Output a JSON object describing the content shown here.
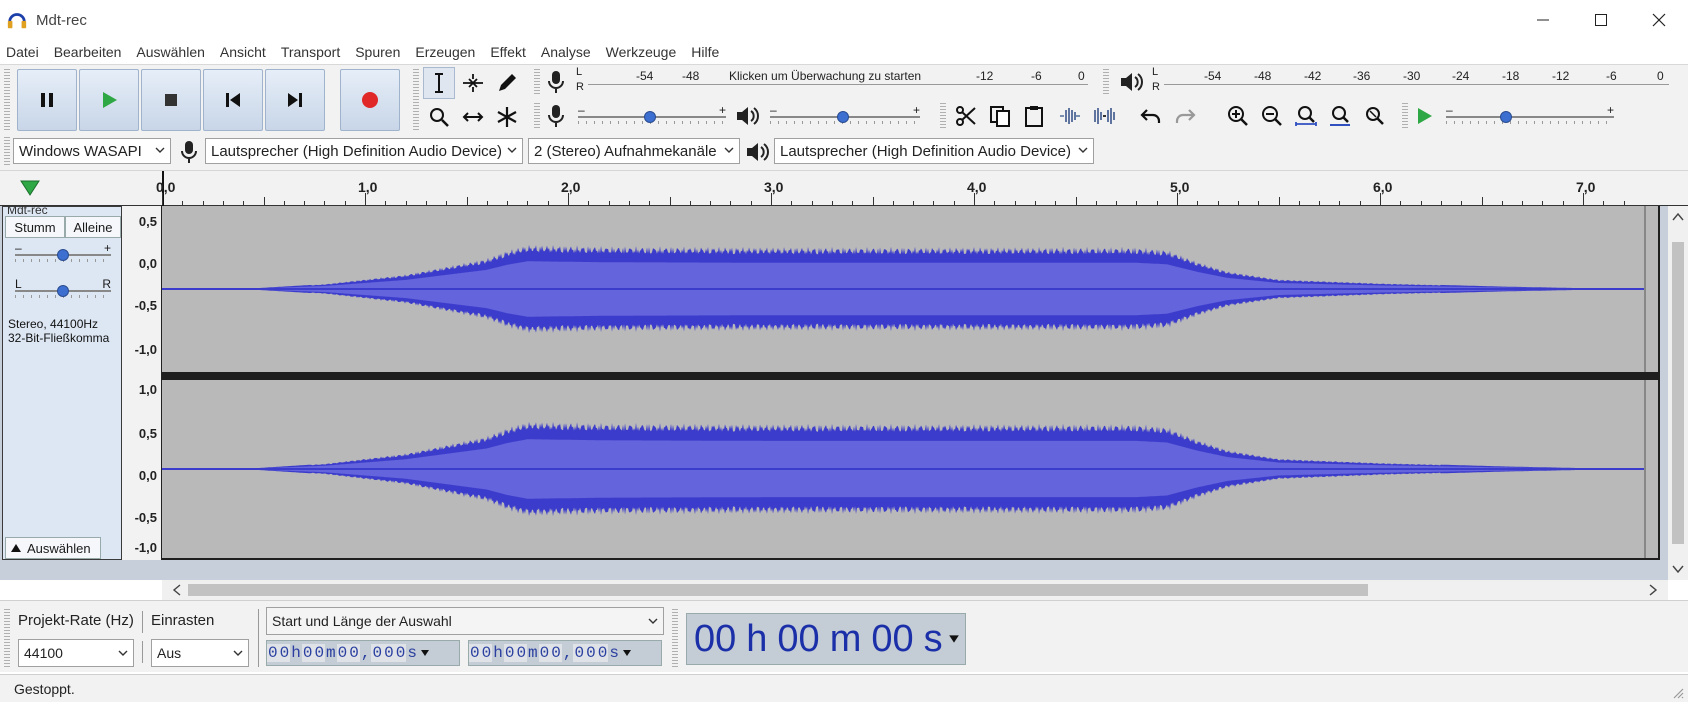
{
  "window": {
    "title": "Mdt-rec"
  },
  "menu": [
    "Datei",
    "Bearbeiten",
    "Auswählen",
    "Ansicht",
    "Transport",
    "Spuren",
    "Erzeugen",
    "Effekt",
    "Analyse",
    "Werkzeuge",
    "Hilfe"
  ],
  "record_meter": {
    "channels": [
      "L",
      "R"
    ],
    "ticks": [
      "-54",
      "-48",
      "-12",
      "-6",
      "0"
    ],
    "hint": "Klicken um Überwachung zu starten"
  },
  "play_meter": {
    "channels": [
      "L",
      "R"
    ],
    "ticks": [
      "-54",
      "-48",
      "-42",
      "-36",
      "-30",
      "-24",
      "-18",
      "-12",
      "-6",
      "0"
    ]
  },
  "sliders": {
    "minus": "–",
    "plus": "+"
  },
  "devices": {
    "host": "Windows WASAPI",
    "recording_device": "Lautsprecher (High Definition Audio Device)",
    "channels": "2 (Stereo) Aufnahmekanäle",
    "playback_device": "Lautsprecher (High Definition Audio Device)"
  },
  "ruler": {
    "labels": [
      "0,0",
      "1,0",
      "2,0",
      "3,0",
      "4,0",
      "5,0",
      "6,0",
      "7,0"
    ]
  },
  "track": {
    "name": "Mdt-rec",
    "mute": "Stumm",
    "solo": "Alleine",
    "gain_minus": "–",
    "gain_plus": "+",
    "pan_left": "L",
    "pan_right": "R",
    "format_line1": "Stereo, 44100Hz",
    "format_line2": "32-Bit-Fließkomma",
    "select_button": "Auswählen",
    "amp_labels": [
      "1,0",
      "0,5",
      "0,0",
      "-0,5",
      "-1,0"
    ]
  },
  "selection_toolbar": {
    "project_rate_label": "Projekt-Rate (Hz)",
    "project_rate_value": "44100",
    "snap_label": "Einrasten",
    "snap_value": "Aus",
    "selection_mode": "Start und Länge der Auswahl",
    "start_time": [
      "0",
      "0",
      "h",
      "0",
      "0",
      "m",
      "0",
      "0",
      ",",
      "0",
      "0",
      "0",
      "s"
    ],
    "length_time": [
      "0",
      "0",
      "h",
      "0",
      "0",
      "m",
      "0",
      "0",
      ",",
      "0",
      "0",
      "0",
      "s"
    ],
    "audio_position": [
      "00",
      "h",
      "00",
      "m",
      "00",
      "s"
    ]
  },
  "status": "Gestoppt.",
  "colors": {
    "waveform": "#3c3ccc",
    "waveform_rms": "#6464dc",
    "waveform_bg": "#b9b9b9",
    "record_button": "#e02828",
    "play_button": "#2ea844"
  },
  "waveform_shape": {
    "duration_seconds": 7.3,
    "envelope": [
      [
        0.0,
        0.0
      ],
      [
        0.4,
        0.0
      ],
      [
        0.8,
        0.06
      ],
      [
        1.2,
        0.18
      ],
      [
        1.6,
        0.38
      ],
      [
        1.7,
        0.48
      ],
      [
        1.8,
        0.55
      ],
      [
        2.2,
        0.53
      ],
      [
        3.0,
        0.52
      ],
      [
        4.0,
        0.52
      ],
      [
        4.8,
        0.52
      ],
      [
        4.95,
        0.49
      ],
      [
        5.1,
        0.34
      ],
      [
        5.25,
        0.22
      ],
      [
        5.5,
        0.12
      ],
      [
        6.0,
        0.07
      ],
      [
        6.6,
        0.03
      ],
      [
        7.0,
        0.01
      ],
      [
        7.3,
        0.0
      ]
    ]
  }
}
